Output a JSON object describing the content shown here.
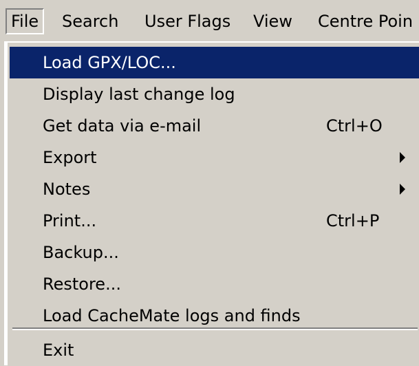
{
  "menubar": {
    "items": [
      {
        "label": "File"
      },
      {
        "label": "Search"
      },
      {
        "label": "User Flags"
      },
      {
        "label": "View"
      },
      {
        "label": "Centre Poin"
      }
    ]
  },
  "file_menu": {
    "items": [
      {
        "label": "Load GPX/LOC...",
        "shortcut": ""
      },
      {
        "label": "Display last change log",
        "shortcut": ""
      },
      {
        "label": "Get data via e-mail",
        "shortcut": "Ctrl+O"
      },
      {
        "label": "Export",
        "shortcut": "",
        "submenu": "chevron-right-icon"
      },
      {
        "label": "Notes",
        "shortcut": "",
        "submenu": "chevron-right-icon"
      },
      {
        "label": "Print...",
        "shortcut": "Ctrl+P"
      },
      {
        "label": "Backup...",
        "shortcut": ""
      },
      {
        "label": "Restore...",
        "shortcut": ""
      },
      {
        "label": "Load CacheMate logs and finds",
        "shortcut": ""
      },
      {
        "label": "Exit",
        "shortcut": ""
      }
    ],
    "selected_item": "Load GPX/LOC..."
  },
  "colors": {
    "menu_background": "#d4d0c8",
    "selection_background": "#0a246a",
    "selection_text": "#ffffff"
  }
}
